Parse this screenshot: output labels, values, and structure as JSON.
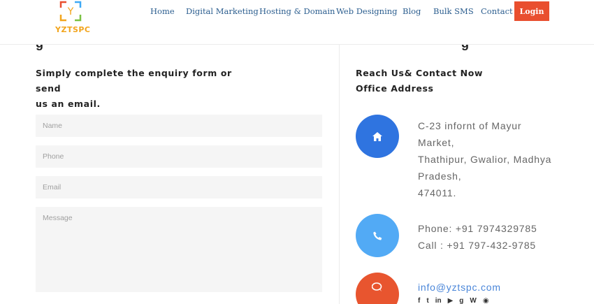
{
  "header": {
    "logo_text": "YZTSPC",
    "logo_letter": "Y",
    "nav": [
      {
        "label": "Home"
      },
      {
        "label": "Digital Marketing"
      },
      {
        "label": "Hosting & Domain"
      },
      {
        "label": "Web Designing"
      },
      {
        "label": "Blog"
      },
      {
        "label": "Bulk SMS"
      },
      {
        "label": "Contact"
      }
    ],
    "login_label": "Login"
  },
  "left": {
    "heading_fragment": "g",
    "intro_line1": "Simply complete the enquiry form or send",
    "intro_line2": "us an email.",
    "form": {
      "name_placeholder": "Name",
      "phone_placeholder": "Phone",
      "email_placeholder": "Email",
      "message_placeholder": "Message"
    }
  },
  "right": {
    "heading_fragment": "g",
    "heading_line1": "Reach Us& Contact Now",
    "heading_line2": "Office Address",
    "address_lines": [
      "C-23 infornt of Mayur",
      "Market,",
      "Thathipur, Gwalior, Madhya",
      "Pradesh,",
      "474011."
    ],
    "phone_line": "Phone: +91 7974329785",
    "call_line": "Call : +91 797-432-9785",
    "email": "info@yztspc.com",
    "social_icons": [
      "facebook-icon",
      "twitter-icon",
      "linkedin-icon",
      "youtube-icon",
      "google-plus-icon",
      "wordpress-icon",
      "rss-icon"
    ]
  },
  "colors": {
    "nav_text": "#2c5e8f",
    "login_bg": "#e94f2f",
    "home_circle": "#2f74e0",
    "phone_circle": "#52aaf5",
    "chat_circle": "#e8552f",
    "email_link": "#4a86d9"
  }
}
